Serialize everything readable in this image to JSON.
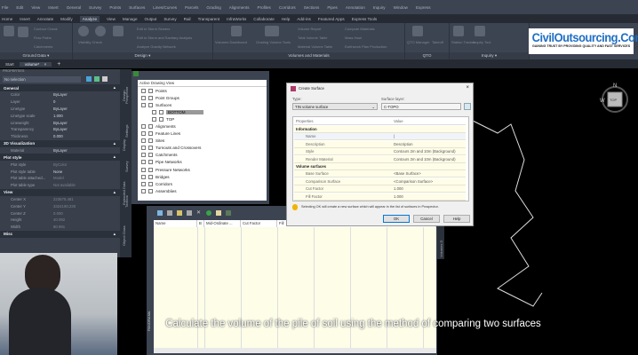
{
  "menubar": [
    "File",
    "Edit",
    "View",
    "Insert",
    "General",
    "Survey",
    "Points",
    "Surfaces",
    "Lines/Curves",
    "Parcels",
    "Grading",
    "Alignments",
    "Profiles",
    "Corridors",
    "Sections",
    "Pipes",
    "Annotation",
    "Inquiry",
    "Window",
    "Express"
  ],
  "ribbon_tabs": [
    "Home",
    "Insert",
    "Annotate",
    "Modify",
    "Analyze",
    "View",
    "Manage",
    "Output",
    "Survey",
    "Rail",
    "Transparent",
    "InfraWorks",
    "Collaborate",
    "Help",
    "Add-ins",
    "Featured Apps",
    "Express Tools"
  ],
  "active_tab": "Analyze",
  "ribbon": {
    "ground_data": {
      "title": "Ground Data ▾",
      "items": [
        "Contour Check",
        "Flow Paths",
        "Catchments",
        "Drainage",
        "Check Paths"
      ]
    },
    "design": {
      "title": "Design ▾",
      "items": [
        "Visibility Check",
        "Drive",
        "Interference Check",
        "Edit in Storm Sewers",
        "Edit in Storm and Sanitary Analysis",
        "Analyze Gravity Network"
      ]
    },
    "volumes": {
      "title": "Volumes and Materials",
      "items": [
        "Volumes Dashboard",
        "Grading Volume Tools",
        "Volume Report",
        "Total Volume Table",
        "Material Volume Table",
        "Compute Materials",
        "Mass Haul",
        "Earthwork Plan Production"
      ]
    },
    "qto": {
      "title": "QTO",
      "items": [
        "QTO Manager",
        "Takeoff"
      ]
    },
    "inquiry": {
      "title": "Inquiry ▾",
      "items": [
        "Station Tracker",
        "Inquiry Tool"
      ]
    }
  },
  "file_tabs": {
    "start": "Start",
    "current": "volume*",
    "close": "×",
    "add": "+"
  },
  "properties": {
    "title": "PROPERTIES",
    "selection": "No selection",
    "sections": [
      {
        "name": "General",
        "rows": [
          [
            "Color",
            "ByLayer"
          ],
          [
            "Layer",
            "0"
          ],
          [
            "Linetype",
            "ByLayer"
          ],
          [
            "Linetype scale",
            "1.000"
          ],
          [
            "Lineweight",
            "ByLayer"
          ],
          [
            "Transparency",
            "ByLayer"
          ],
          [
            "Thickness",
            "0.000"
          ]
        ]
      },
      {
        "name": "3D Visualization",
        "rows": [
          [
            "Material",
            "ByLayer"
          ]
        ]
      },
      {
        "name": "Plot style",
        "rows": [
          [
            "Plot style",
            "ByColor"
          ],
          [
            "Plot style table",
            "None"
          ],
          [
            "Plot table attached...",
            "Model"
          ],
          [
            "Plot table type",
            "Not available"
          ]
        ]
      },
      {
        "name": "View",
        "rows": [
          [
            "Center X",
            "223675.481"
          ],
          [
            "Center Y",
            "3324190.230"
          ],
          [
            "Center Z",
            "0.000"
          ],
          [
            "Height",
            "40.092"
          ],
          [
            "Width",
            "80.991"
          ]
        ]
      },
      {
        "name": "Misc",
        "rows": []
      }
    ],
    "vtabs": [
      "Design",
      "Display",
      "Extended Data",
      "Object Class"
    ]
  },
  "toolspace": {
    "view": "Active Drawing View",
    "vtabs": [
      "Prospector",
      "Settings",
      "Survey",
      "Toolbox"
    ],
    "tree": [
      {
        "label": "Points",
        "level": 1
      },
      {
        "label": "Point Groups",
        "level": 1
      },
      {
        "label": "Surfaces",
        "level": 1
      },
      {
        "label": "BOTTOM",
        "level": 2,
        "selected": true
      },
      {
        "label": "TOP",
        "level": 2
      },
      {
        "label": "Alignments",
        "level": 1
      },
      {
        "label": "Feature Lines",
        "level": 1
      },
      {
        "label": "Sites",
        "level": 1
      },
      {
        "label": "Turnouts and Crossovers",
        "level": 1
      },
      {
        "label": "Catchments",
        "level": 1
      },
      {
        "label": "Pipe Networks",
        "level": 1
      },
      {
        "label": "Pressure Networks",
        "level": 1
      },
      {
        "label": "Bridges",
        "level": 1
      },
      {
        "label": "Corridors",
        "level": 1
      },
      {
        "label": "Assemblies",
        "level": 1
      }
    ]
  },
  "panorama": {
    "label": "PANORAMA",
    "columns": [
      "Name",
      "B",
      "Mid-Ordinate ...",
      "Cut Factor",
      "Fill"
    ]
  },
  "dialog": {
    "title": "Create Surface",
    "close": "×",
    "type_label": "Type:",
    "type_value": "TIN volume surface",
    "layer_label": "Surface layer:",
    "layer_value": "C-TOPO",
    "col_props": "Properties",
    "col_value": "Value",
    "sections": [
      {
        "name": "Information",
        "rows": [
          [
            "Name",
            "|"
          ],
          [
            "Description",
            "Description"
          ],
          [
            "Style",
            "Contours 2m and 10m (Background)"
          ],
          [
            "Render Material",
            "Contours 2m and 10m (Background)"
          ]
        ]
      },
      {
        "name": "Volume surfaces",
        "rows": [
          [
            "Base Surface",
            "<Base Surface>"
          ],
          [
            "Comparison Surface",
            "<Comparison Surface>"
          ],
          [
            "Cut Factor",
            "1.000"
          ],
          [
            "Fill Factor",
            "1.000"
          ]
        ]
      }
    ],
    "info": "Selecting OK will create a new surface which will appear in the list of surfaces in Prospector.",
    "ok": "OK",
    "cancel": "Cancel",
    "help": "Help"
  },
  "viewcube": {
    "n": "N",
    "w": "W",
    "top": "TOP"
  },
  "right_vtab": "Volumes D",
  "logo": {
    "name": "CivilOutsourcing.Com",
    "tagline": "GAINING TRUST BY PROVIDING QUALITY AND FAST SERVICES"
  },
  "subtitle": "Calculate the volume of the pile of soil using the method of comparing two surfaces",
  "colors": {
    "chrome": "#3c4452",
    "dark": "#262b33",
    "logo_blue": "#1f6fc4",
    "grid": "#fdfde8"
  }
}
